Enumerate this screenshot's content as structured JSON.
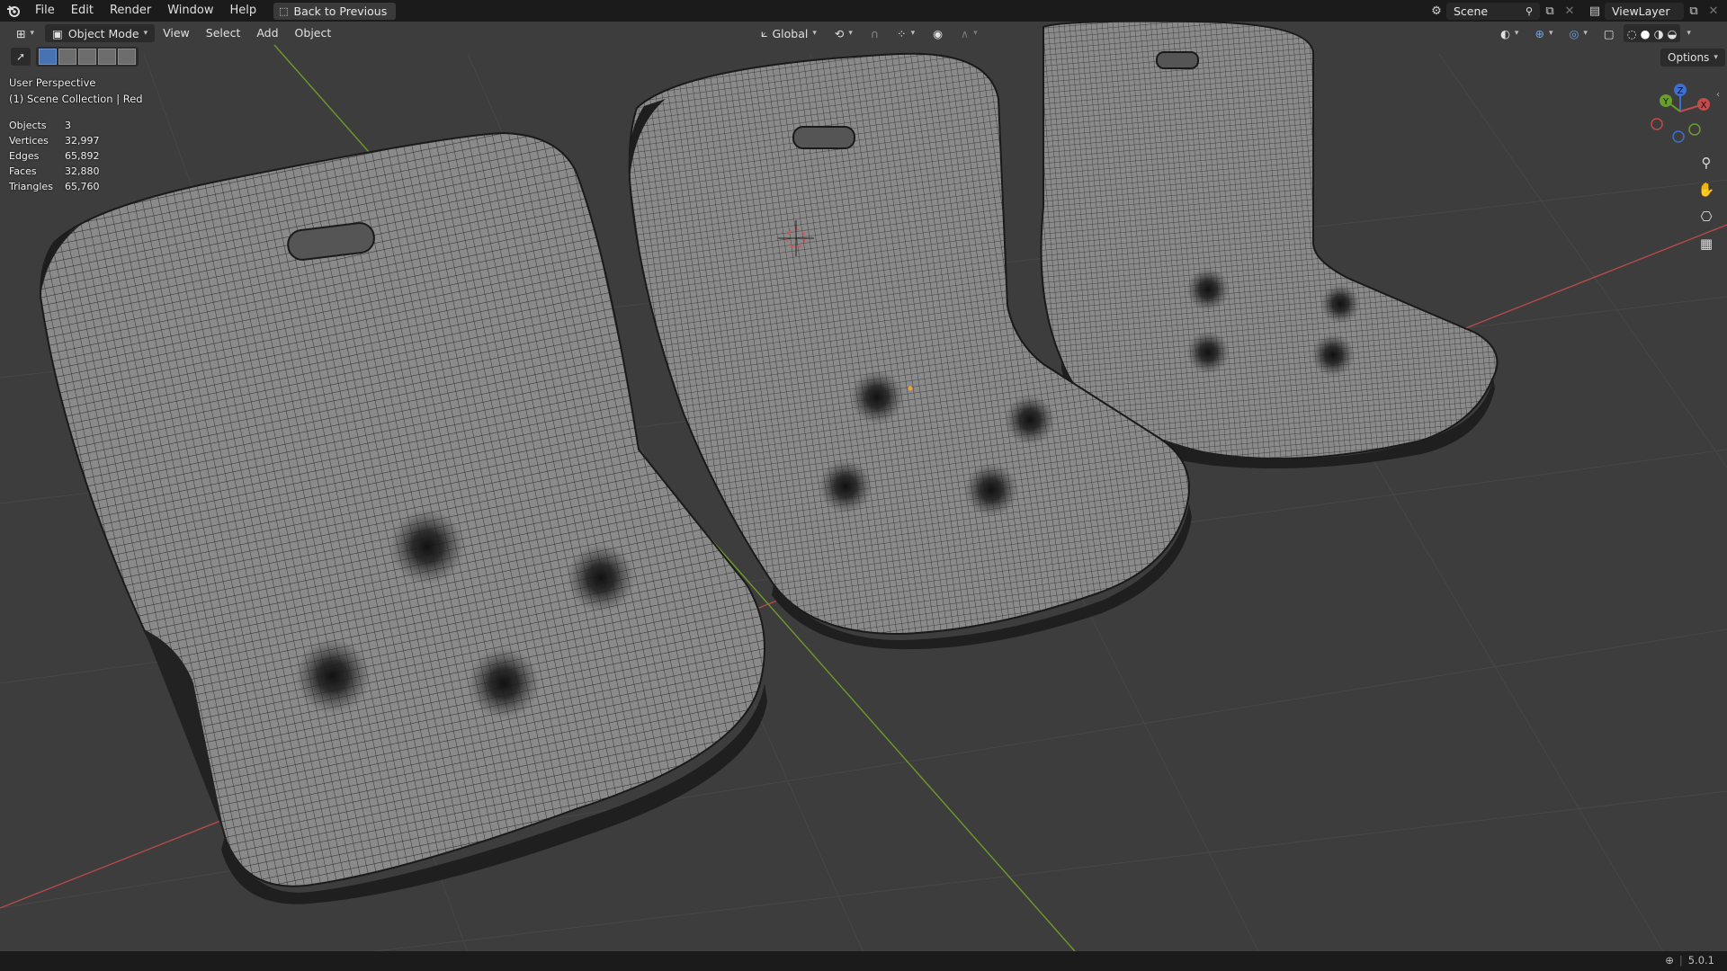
{
  "topbar": {
    "menus": [
      "File",
      "Edit",
      "Render",
      "Window",
      "Help"
    ],
    "back_label": "Back to Previous",
    "scene": "Scene",
    "view_layer": "ViewLayer"
  },
  "viewport_header": {
    "mode": "Object Mode",
    "menus": [
      "View",
      "Select",
      "Add",
      "Object"
    ],
    "transform_orientation": "Global",
    "options_label": "Options"
  },
  "overlay": {
    "perspective": "User Perspective",
    "collection": "(1) Scene Collection | Red",
    "stats": [
      {
        "label": "Objects",
        "value": "3"
      },
      {
        "label": "Vertices",
        "value": "32,997"
      },
      {
        "label": "Edges",
        "value": "65,892"
      },
      {
        "label": "Faces",
        "value": "32,880"
      },
      {
        "label": "Triangles",
        "value": "65,760"
      }
    ]
  },
  "gizmo": {
    "x": "X",
    "y": "Y",
    "z": "Z"
  },
  "status": {
    "version": "5.0.1"
  },
  "colors": {
    "x_axis": "#b34a4a",
    "y_axis": "#6f9a2a",
    "background": "#3d3d3d"
  }
}
